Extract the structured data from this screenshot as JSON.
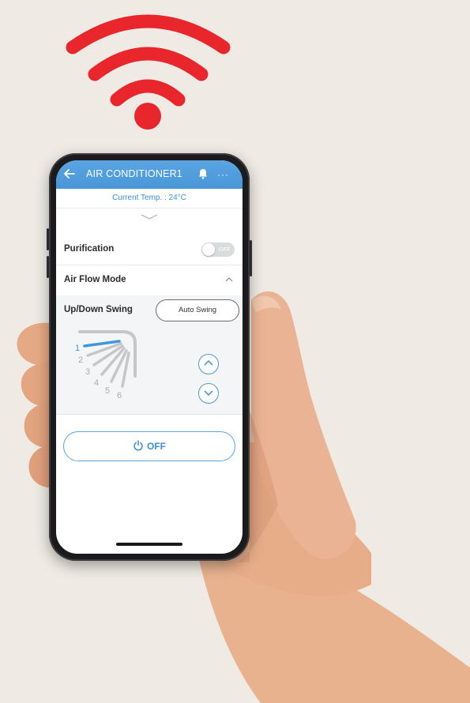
{
  "colors": {
    "wifi": "#e8262b",
    "accent": "#4996d8",
    "background": "#efebe4"
  },
  "app": {
    "title": "AIR CONDITIONER1",
    "back_icon": "back-arrow-icon",
    "bell_icon": "bell-icon",
    "more_icon": "more-icon",
    "more_label": "···",
    "current_temp": "Current Temp. : 24°C"
  },
  "purification": {
    "label": "Purification",
    "toggle_text": "OFF",
    "state": false
  },
  "air_flow": {
    "label": "Air Flow Mode"
  },
  "swing": {
    "label": "Up/Down Swing",
    "auto_button": "Auto Swing",
    "positions": [
      "1",
      "2",
      "3",
      "4",
      "5",
      "6"
    ],
    "selected_position": "1"
  },
  "power": {
    "label": "OFF"
  }
}
